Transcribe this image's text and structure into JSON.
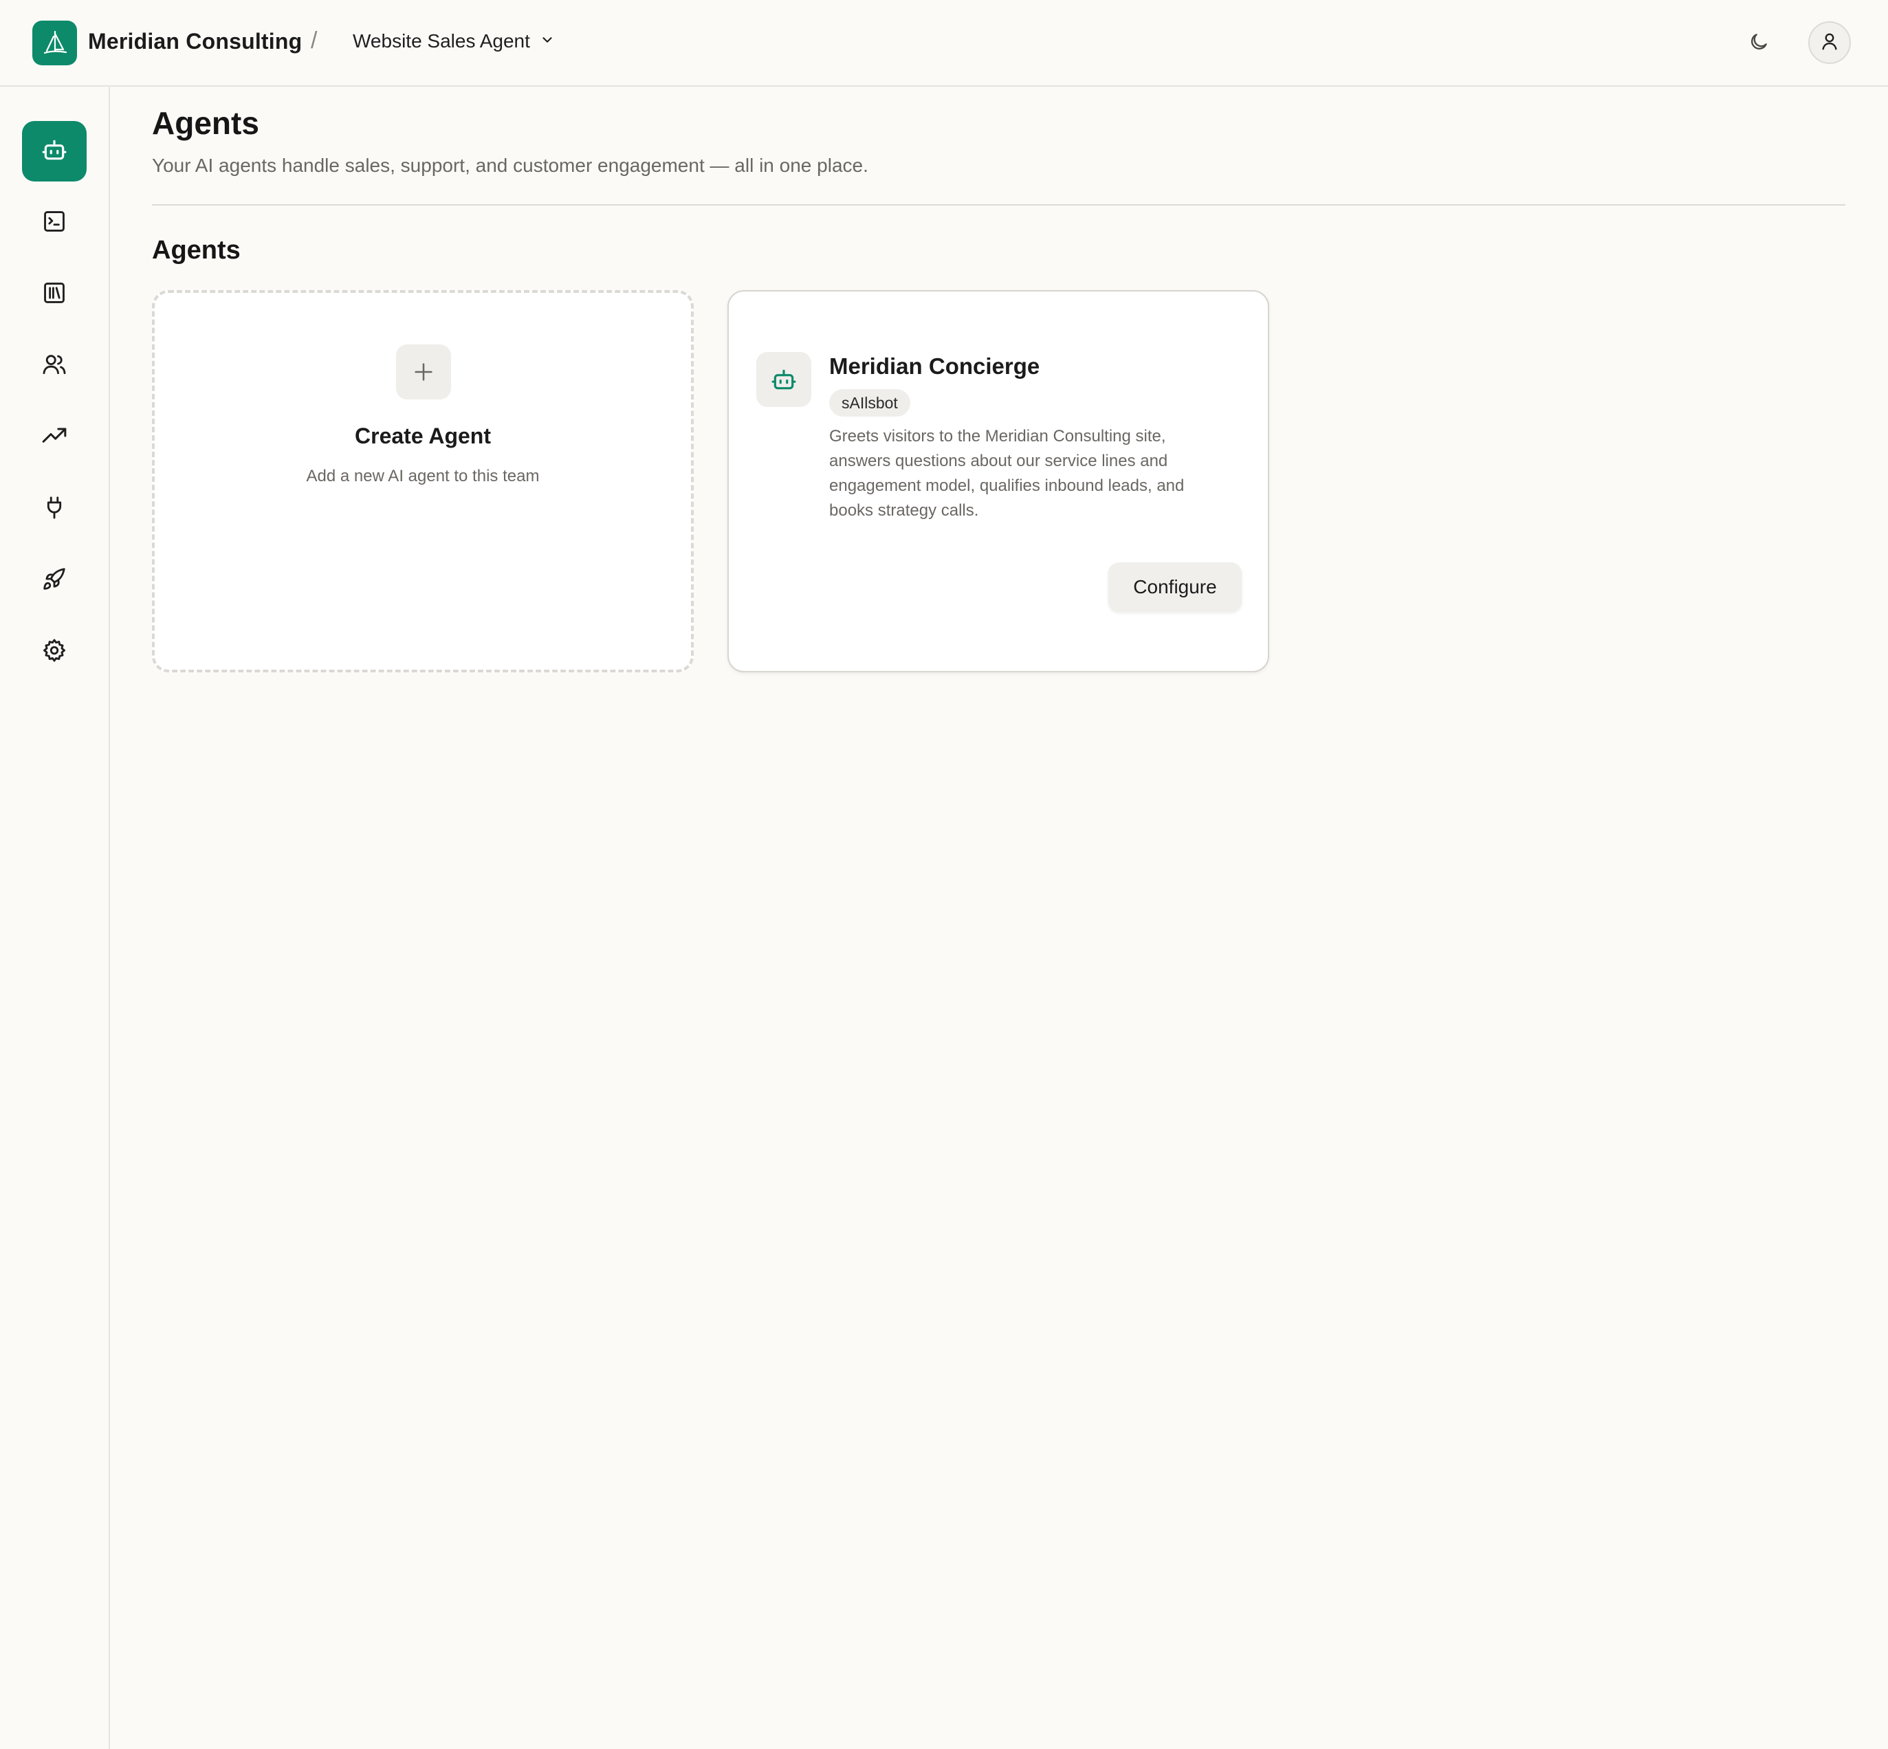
{
  "header": {
    "brand_name": "Meridian Consulting",
    "separator": "/",
    "team_selector": "Website Sales Agent",
    "icons": {
      "logo": "sailboat-logo",
      "dropdown": "chevron-down-icon",
      "theme": "moon-icon",
      "user": "user-icon"
    }
  },
  "sidebar": {
    "items": [
      {
        "icon": "bot-icon",
        "active": true
      },
      {
        "icon": "terminal-icon",
        "active": false
      },
      {
        "icon": "library-icon",
        "active": false
      },
      {
        "icon": "users-icon",
        "active": false
      },
      {
        "icon": "trending-up-icon",
        "active": false
      },
      {
        "icon": "plug-icon",
        "active": false
      },
      {
        "icon": "rocket-icon",
        "active": false
      },
      {
        "icon": "settings-icon",
        "active": false
      }
    ]
  },
  "main": {
    "title": "Agents",
    "subtitle": "Your AI agents handle sales, support, and customer engagement — all in one place.",
    "section_title": "Agents",
    "create_card": {
      "title": "Create Agent",
      "description": "Add a new AI agent to this team"
    },
    "agents": [
      {
        "name": "Meridian Concierge",
        "badge": "sAIlsbot",
        "description": "Greets visitors to the Meridian Consulting site, answers questions about our service lines and engagement model, qualifies inbound leads, and books strategy calls.",
        "action_label": "Configure"
      }
    ]
  },
  "colors": {
    "accent": "#0d8a6a",
    "background": "#fcfaf7",
    "card": "#ffffff",
    "muted_text": "#6a6763"
  }
}
